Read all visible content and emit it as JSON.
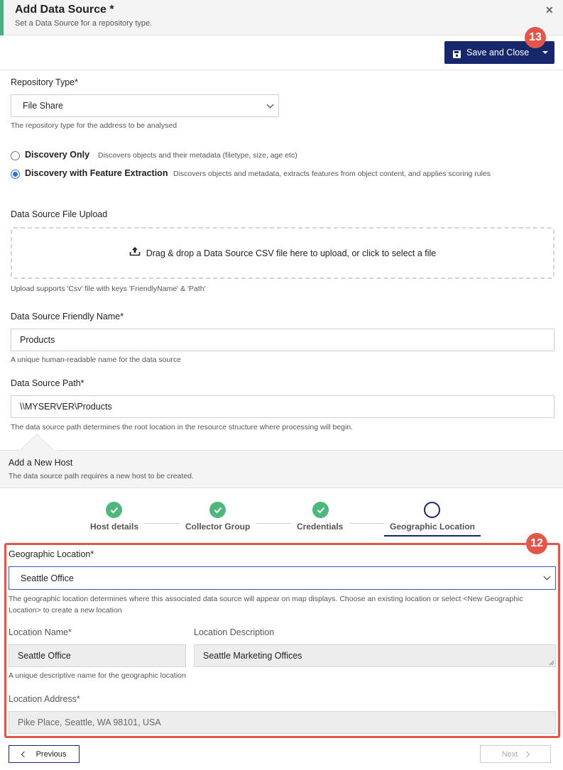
{
  "header": {
    "title": "Add Data Source *",
    "subtitle": "Set a Data Source for a repository type.",
    "close_icon": "close-icon"
  },
  "toolbar": {
    "save_label": "Save and Close",
    "save_icon": "floppy-disk-icon",
    "badge": "13"
  },
  "repository": {
    "label": "Repository Type*",
    "value": "File Share",
    "help": "The repository type for the address to be analysed"
  },
  "discovery": {
    "options": [
      {
        "label": "Discovery Only",
        "desc": "Discovers objects and their metadata (filetype, size, age etc)",
        "selected": false
      },
      {
        "label": "Discovery with Feature Extraction",
        "desc": "Discovers objects and metadata, extracts features from object content, and applies scoring rules",
        "selected": true
      }
    ]
  },
  "upload": {
    "label": "Data Source File Upload",
    "dropzone_text": "Drag & drop a Data Source CSV file here to upload, or click to select a file",
    "help": "Upload supports 'Csv' file with keys 'FriendlyName' & 'Path'"
  },
  "friendly_name": {
    "label": "Data Source Friendly Name*",
    "value": "Products",
    "help": "A unique human-readable name for the data source"
  },
  "path": {
    "label": "Data Source Path*",
    "value": "\\\\MYSERVER\\Products",
    "help": "The data source path determines the root location in the resource structure where processing will begin."
  },
  "host": {
    "title": "Add a New Host",
    "desc": "The data source path requires a new host to be created."
  },
  "steps": [
    {
      "label": "Host details",
      "state": "complete"
    },
    {
      "label": "Collector Group",
      "state": "complete"
    },
    {
      "label": "Credentials",
      "state": "complete"
    },
    {
      "label": "Geographic Location",
      "state": "active"
    }
  ],
  "geo": {
    "badge": "12",
    "label": "Geographic Location*",
    "value": "Seattle Office",
    "help": "The geographic location determines where this associated data source will appear on map displays. Choose an existing location or select <New Geographic Location> to create a new location",
    "location_name_label": "Location Name*",
    "location_name_value": "Seattle Office",
    "location_name_help": "A unique descriptive name for the geographic location",
    "location_desc_label": "Location Description",
    "location_desc_value": "Seattle Marketing Offices",
    "address_label": "Location Address*",
    "address_value": "Pike Place, Seattle, WA 98101, USA"
  },
  "nav": {
    "previous": "Previous",
    "next": "Next"
  },
  "colors": {
    "primary": "#16276b",
    "success": "#4cb87b",
    "annotation": "#e5564a",
    "radio_selected": "#2d6ee0"
  }
}
